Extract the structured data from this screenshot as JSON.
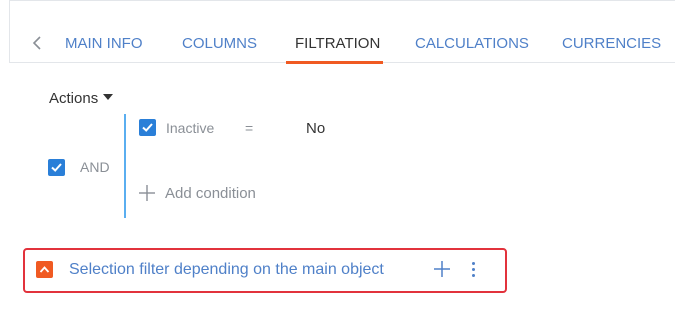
{
  "tabs": [
    {
      "label": "MAIN INFO",
      "active": false
    },
    {
      "label": "COLUMNS",
      "active": false
    },
    {
      "label": "FILTRATION",
      "active": true
    },
    {
      "label": "CALCULATIONS",
      "active": false
    },
    {
      "label": "CURRENCIES",
      "active": false
    }
  ],
  "actions_label": "Actions",
  "group": {
    "operator": "AND",
    "checked": true,
    "conditions": [
      {
        "checked": true,
        "field": "Inactive",
        "operator": "=",
        "value": "No"
      }
    ],
    "add_condition_label": "Add condition"
  },
  "selection_filter": {
    "title": "Selection filter depending on the main object"
  },
  "colors": {
    "accent_blue": "#4f80c8",
    "checkbox_blue": "#2a7fd8",
    "active_orange": "#f05a22",
    "highlight_red": "#e2323c"
  },
  "icons": [
    "chevron-left-icon",
    "caret-down-icon",
    "checkmark-icon",
    "plus-icon",
    "chevron-up-icon",
    "more-vertical-icon"
  ]
}
